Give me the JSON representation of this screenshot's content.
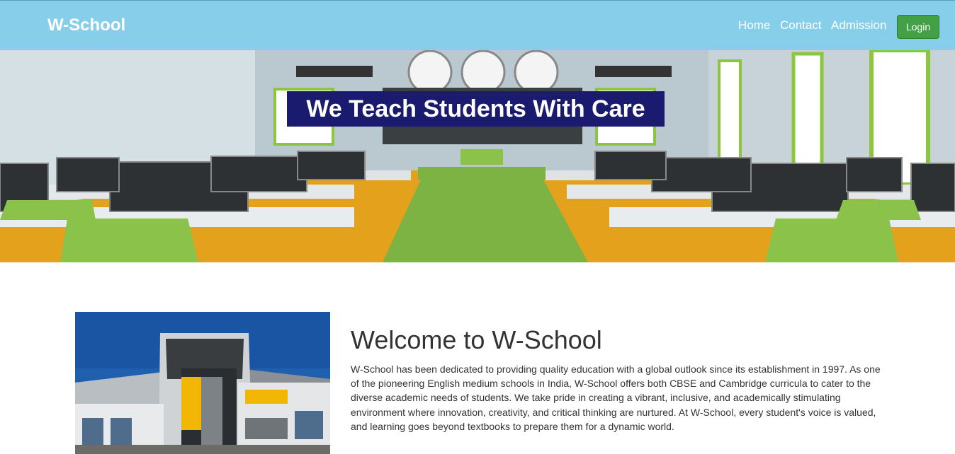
{
  "navbar": {
    "brand": "W-School",
    "links": [
      "Home",
      "Contact",
      "Admission"
    ],
    "login_label": "Login",
    "background": "#87ceeb",
    "login_color": "#43a047"
  },
  "hero": {
    "title": "We Teach Students With Care",
    "title_background": "#1a1a6e"
  },
  "welcome": {
    "heading": "Welcome to W-School",
    "paragraph": "W-School has been dedicated to providing quality education with a global outlook since its establishment in 1997. As one of the pioneering English medium schools in India, W-School offers both CBSE and Cambridge curricula to cater to the diverse academic needs of students. We take pride in creating a vibrant, inclusive, and academically stimulating environment where innovation, creativity, and critical thinking are nurtured. At W-School, every student's voice is valued, and learning goes beyond textbooks to prepare them for a dynamic world."
  }
}
